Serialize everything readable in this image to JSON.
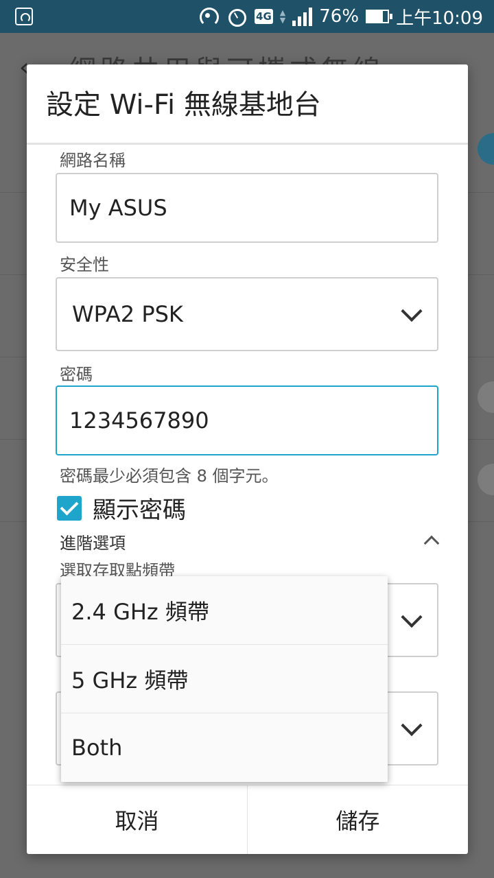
{
  "status_bar": {
    "network": "4G",
    "battery": "76%",
    "time": "上午10:09"
  },
  "background": {
    "title": "網路共用與可攜式無線"
  },
  "dialog": {
    "title": "設定 Wi-Fi 無線基地台",
    "network_name_label": "網路名稱",
    "network_name_value": "My ASUS",
    "security_label": "安全性",
    "security_value": "WPA2 PSK",
    "password_label": "密碼",
    "password_value": "1234567890",
    "password_hint": "密碼最少必須包含 8 個字元。",
    "show_password_label": "顯示密碼",
    "show_password_checked": true,
    "advanced_label": "進階選項",
    "band_label": "選取存取點頻帶",
    "cancel_label": "取消",
    "save_label": "儲存"
  },
  "band_dropdown": {
    "options": [
      "2.4 GHz 頻帶",
      "5 GHz 頻帶",
      "Both"
    ]
  },
  "colors": {
    "status_bar": "#1f5269",
    "accent": "#1fa5cb"
  }
}
